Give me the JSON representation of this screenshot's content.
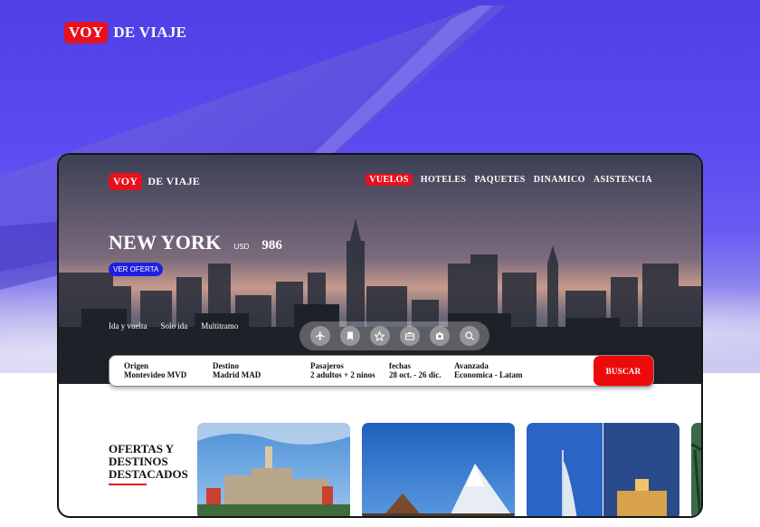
{
  "brand": {
    "voy": "VOY",
    "rest": "DE VIAJE"
  },
  "nav": {
    "items": [
      {
        "label": "VUELOS",
        "active": true
      },
      {
        "label": "HOTELES",
        "active": false
      },
      {
        "label": "PAQUETES",
        "active": false
      },
      {
        "label": "DINAMICO",
        "active": false
      },
      {
        "label": "ASISTENCIA",
        "active": false
      }
    ]
  },
  "hero": {
    "city": "NEW YORK",
    "currency": "USD",
    "price": "986",
    "offer_button": "VER OFERTA"
  },
  "trip_types": [
    "Ida y vuelta",
    "Solo ida",
    "Multitramo"
  ],
  "categories": [
    "plane-icon",
    "bookmark-icon",
    "star-icon",
    "briefcase-icon",
    "camera-icon",
    "search-icon"
  ],
  "search": {
    "fields": [
      {
        "label": "Origen",
        "value": "Montevideo MVD"
      },
      {
        "label": "Destino",
        "value": "Madrid MAD"
      },
      {
        "label": "Pasajeros",
        "value": "2 adultos + 2 ninos"
      },
      {
        "label": "fechas",
        "value": "28 oct. - 26 dic."
      },
      {
        "label": "Avanzada",
        "value": "Economica - Latam"
      }
    ],
    "button": "BUSCAR"
  },
  "offers": {
    "title_lines": [
      "OFERTAS Y",
      "DESTINOS",
      "DESTACADOS"
    ]
  },
  "colors": {
    "accent": "#e8101c",
    "offer_button": "#1f1fe0",
    "background": "#5b4bf0"
  }
}
